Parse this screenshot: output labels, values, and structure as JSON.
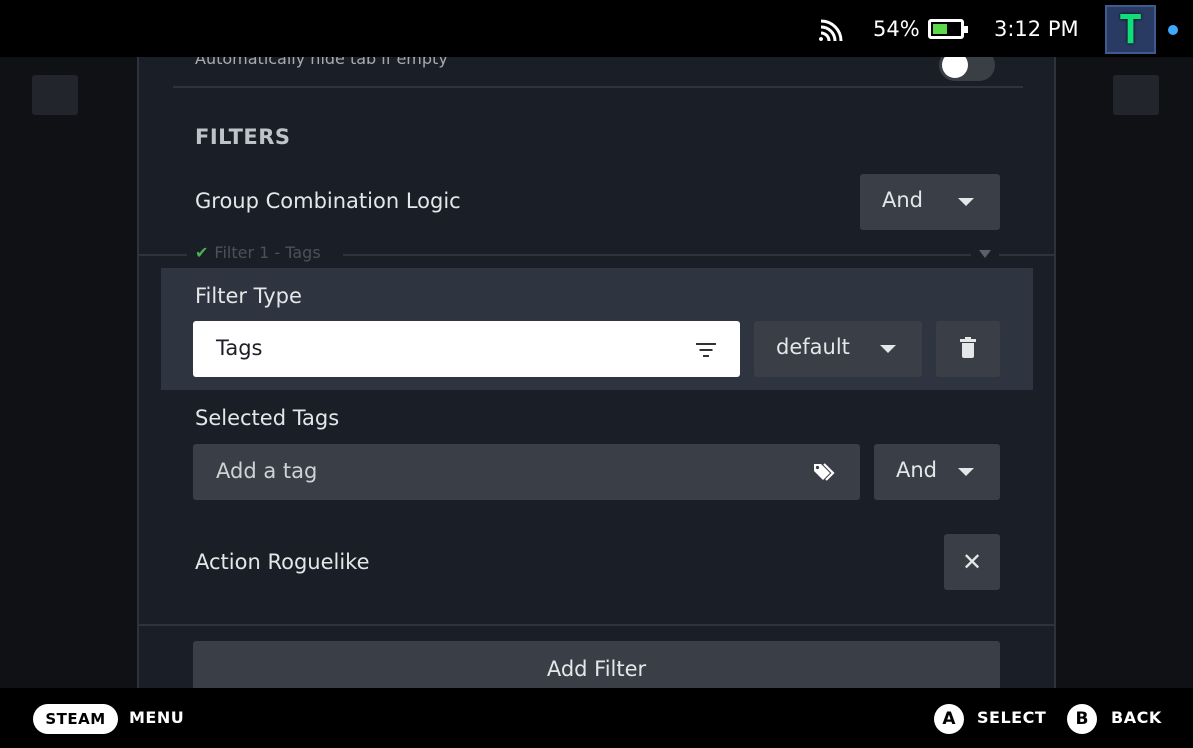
{
  "status": {
    "battery_percent": "54%",
    "battery_level": 0.54,
    "time": "3:12 PM",
    "avatar_letter": "T"
  },
  "settings": {
    "auto_hide_label": "Automatically hide tab if empty",
    "auto_hide_enabled": false
  },
  "filters": {
    "section_title": "FILTERS",
    "group_logic_label": "Group Combination Logic",
    "group_logic_value": "And",
    "filter_legend": "Filter 1 - Tags",
    "filter_type_label": "Filter Type",
    "filter_type_value": "Tags",
    "mode_value": "default",
    "selected_tags_label": "Selected Tags",
    "tag_input_placeholder": "Add a tag",
    "tag_logic_value": "And",
    "tags": [
      "Action Roguelike"
    ],
    "add_filter_label": "Add Filter"
  },
  "bottom_bar": {
    "steam_label": "STEAM",
    "menu_label": "MENU",
    "a_glyph": "A",
    "select_label": "SELECT",
    "b_glyph": "B",
    "back_label": "BACK"
  },
  "colors": {
    "modal_bg": "#1a1f27",
    "highlight_bg": "#2f3540",
    "control_bg": "#3a3f47",
    "battery_fill": "#5dd84a",
    "check_green": "#4caf50",
    "online_dot": "#3fa9ff"
  },
  "icons": [
    "wifi-icon",
    "battery-icon",
    "caret-down-icon",
    "filter-list-icon",
    "trash-icon",
    "tag-icon",
    "close-icon",
    "check-icon"
  ]
}
